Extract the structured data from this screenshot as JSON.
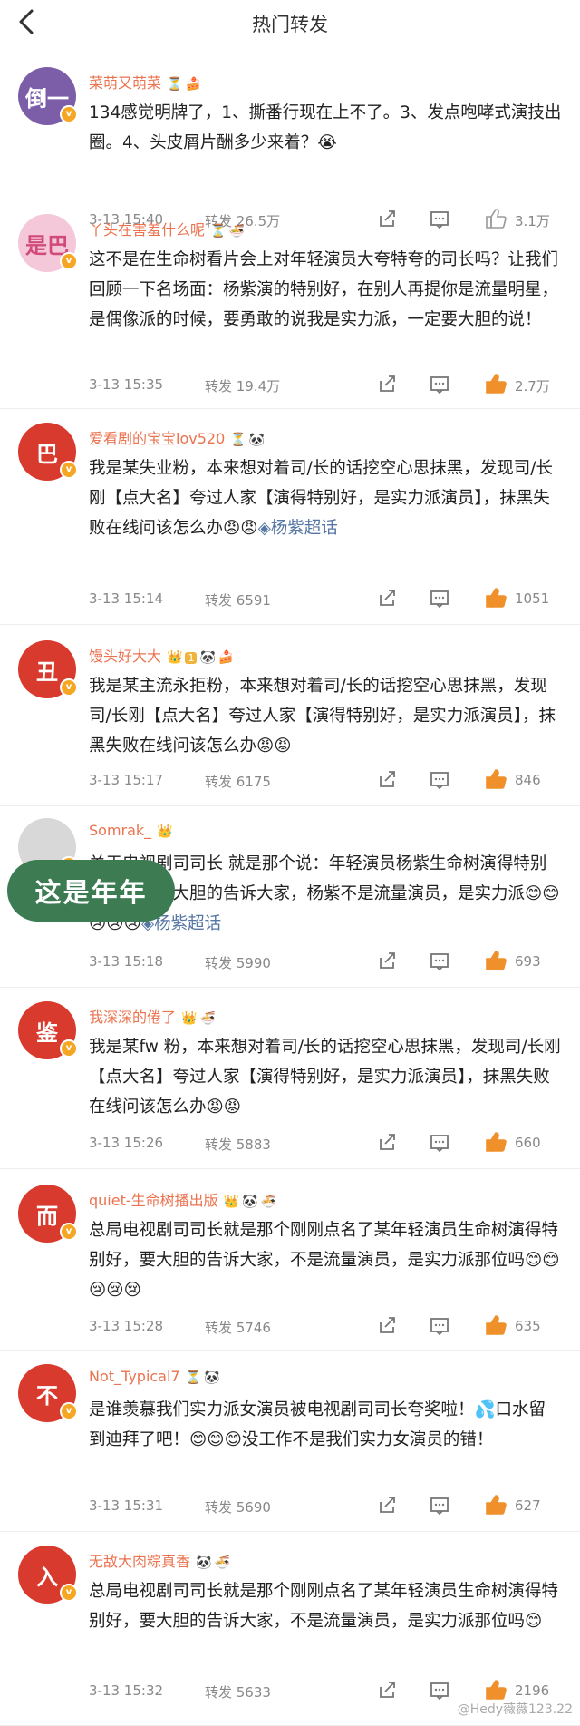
{
  "header": {
    "title": "热门转发"
  },
  "overlay_text": "这是年年",
  "watermark": "@Hedy薇薇123.22",
  "colors": {
    "username": "#eb7350",
    "like_active": "#f0902a",
    "topic": "#5676a3",
    "overlay": "#3d7c52"
  },
  "items": [
    {
      "avatar": "倒一",
      "avatar_bg": "#7b5ea7",
      "username": "菜萌又萌菜",
      "badges": [
        "⏳",
        "🍰"
      ],
      "text": "134感觉明牌了，1、撕番行现在上不了。3、发点咆哮式演技出圈。4、头皮屑片酬多少来着？😭",
      "topic": "",
      "time": "3-13 15:40",
      "forward": "转发 26.5万",
      "likes": "3.1万",
      "liked": false
    },
    {
      "avatar": "是巴",
      "avatar_bg": "#f4c8d8",
      "avatar_fg": "#d24a7a",
      "username": "丫头在害羞什么呢",
      "badges": [
        "⏳",
        "🍜"
      ],
      "text": "这不是在生命树看片会上对年轻演员大夸特夸的司长吗？让我们回顾一下名场面：杨紫演的特别好，在别人再提你是流量明星，是偶像派的时候，要勇敢的说我是实力派，一定要大胆的说！",
      "topic": "",
      "time": "3-13 15:35",
      "forward": "转发 19.4万",
      "likes": "2.7万",
      "liked": true
    },
    {
      "avatar": "巴",
      "avatar_bg": "#d93a2e",
      "username": "爱看剧的宝宝lov520",
      "badges": [
        "⏳",
        "🐼"
      ],
      "text": "我是某失业粉，本来想对着司/长的话挖空心思抹黑，发现司/长刚【点大名】夸过人家【演得特别好，是实力派演员】，抹黑失败在线问该怎么办😡😡",
      "topic": "◈杨紫超话",
      "time": "3-13 15:14",
      "forward": "转发 6591",
      "likes": "1051",
      "liked": true
    },
    {
      "avatar": "丑",
      "avatar_bg": "#d93a2e",
      "username": "馒头好大大",
      "badges": [
        "👑",
        "1",
        "🐼",
        "🍰"
      ],
      "text": "我是某主流永拒粉，本来想对着司/长的话挖空心思抹黑，发现司/长刚【点大名】夸过人家【演得特别好，是实力派演员】，抹黑失败在线问该怎么办😡😡",
      "topic": "",
      "time": "3-13 15:17",
      "forward": "转发 6175",
      "likes": "846",
      "liked": true
    },
    {
      "avatar": "",
      "avatar_bg": "#d8d8d8",
      "username": "Somrak_",
      "badges": [
        "👑"
      ],
      "text": "关于电视剧司司长 就是那个说：年轻演员杨紫生命树演得特别好，要杨紫大胆的告诉大家，杨紫不是流量演员，是实力派😊😊😢😢😢",
      "topic": "◈杨紫超话",
      "time": "3-13 15:18",
      "forward": "转发 5990",
      "likes": "693",
      "liked": true
    },
    {
      "avatar": "鉴",
      "avatar_bg": "#d93a2e",
      "username": "我深深的倦了",
      "badges": [
        "👑",
        "🍜"
      ],
      "text": "我是某fw 粉，本来想对着司/长的话挖空心思抹黑，发现司/长刚【点大名】夸过人家【演得特别好，是实力派演员】，抹黑失败在线问该怎么办😡😡",
      "topic": "",
      "time": "3-13 15:26",
      "forward": "转发 5883",
      "likes": "660",
      "liked": true
    },
    {
      "avatar": "而",
      "avatar_bg": "#d93a2e",
      "username": "quiet-生命树播出版",
      "badges": [
        "👑",
        "🐼",
        "🍜"
      ],
      "text": "总局电视剧司司长就是那个刚刚点名了某年轻演员生命树演得特别好，要大胆的告诉大家，不是流量演员，是实力派那位吗😊😊😢😢😢",
      "topic": "",
      "time": "3-13 15:28",
      "forward": "转发 5746",
      "likes": "635",
      "liked": true
    },
    {
      "avatar": "不",
      "avatar_bg": "#d93a2e",
      "username": "Not_Typical7",
      "badges": [
        "⏳",
        "🐼"
      ],
      "text": "是谁羡慕我们实力派女演员被电视剧司司长夸奖啦！💦口水留到迪拜了吧！😊😊😊没工作不是我们实力女演员的错！",
      "topic": "",
      "time": "3-13 15:31",
      "forward": "转发 5690",
      "likes": "627",
      "liked": true
    },
    {
      "avatar": "入",
      "avatar_bg": "#d93a2e",
      "username": "无敌大肉粽真香",
      "badges": [
        "🐼",
        "🍜"
      ],
      "text": "总局电视剧司司长就是那个刚刚点名了某年轻演员生命树演得特别好，要大胆的告诉大家，不是流量演员，是实力派那位吗😊",
      "topic": "",
      "time": "3-13 15:32",
      "forward": "转发 5633",
      "likes": "2196",
      "liked": true
    }
  ]
}
